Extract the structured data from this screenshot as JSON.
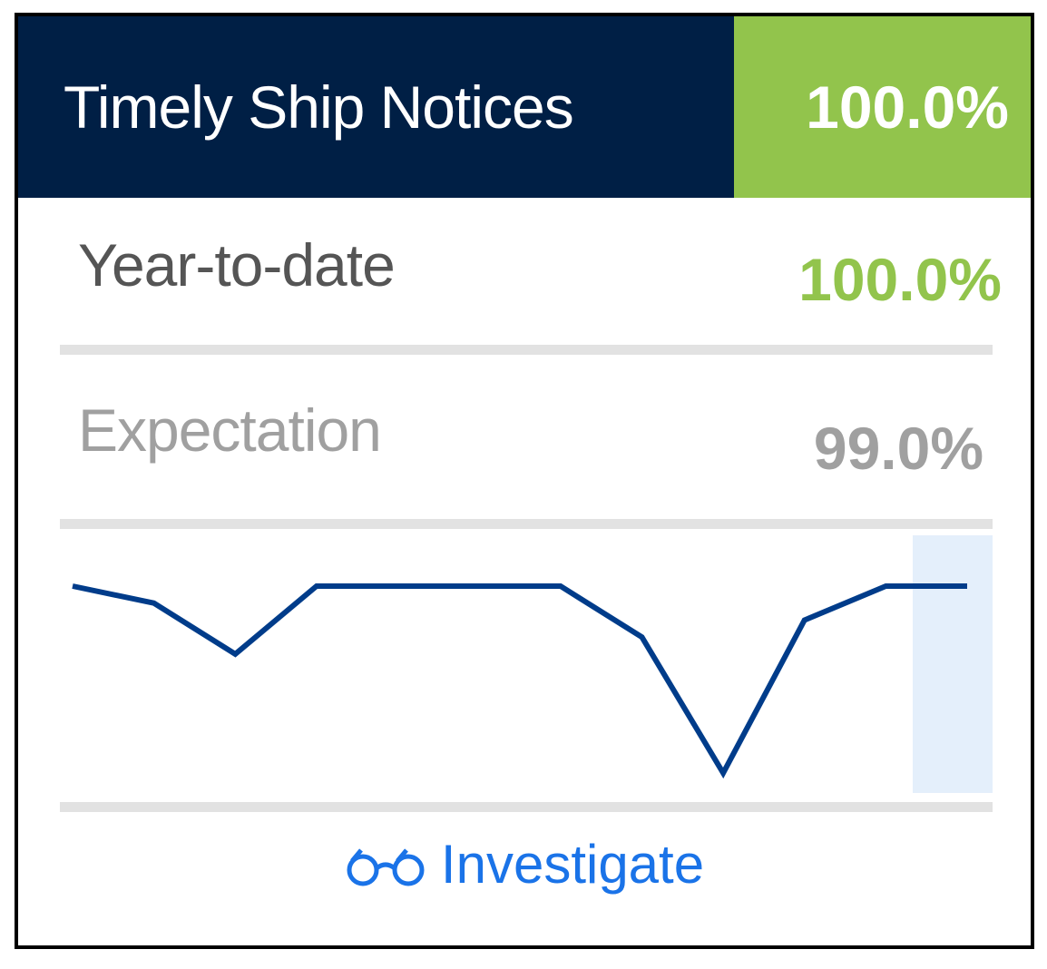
{
  "card": {
    "title": "Timely Ship Notices",
    "current_value": "100.0%",
    "colors": {
      "header_bg": "#001f45",
      "good": "#92c44c",
      "muted": "#a0a0a0",
      "link": "#1a73e8",
      "line": "#003c8a",
      "highlight": "#e4effb"
    }
  },
  "rows": [
    {
      "label": "Year-to-date",
      "value": "100.0%"
    },
    {
      "label": "Expectation",
      "value": "99.0%"
    }
  ],
  "chart_data": {
    "type": "line",
    "values": [
      100,
      99.8,
      99.2,
      100,
      100,
      100,
      100,
      99.4,
      97.8,
      99.6,
      100,
      100
    ],
    "highlight_last": true,
    "grid": false
  },
  "actions": {
    "investigate_label": "Investigate",
    "investigate_icon": "glasses-icon"
  }
}
